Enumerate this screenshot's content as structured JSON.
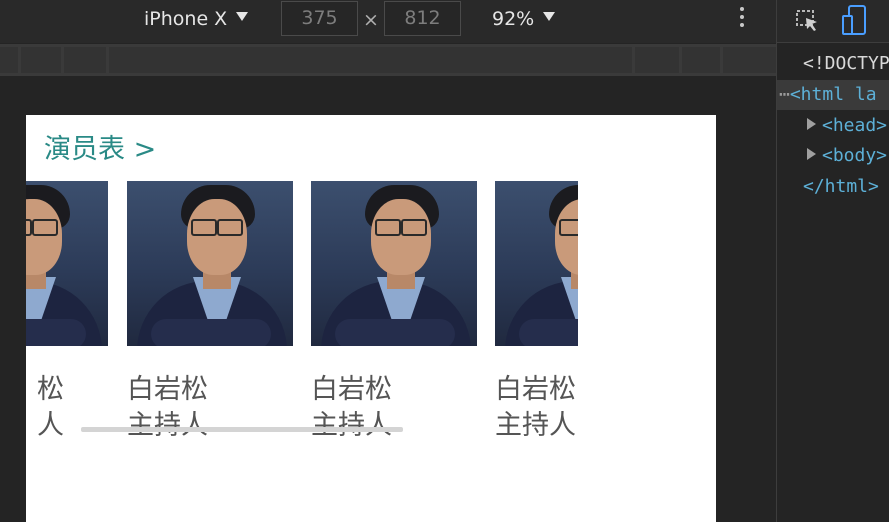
{
  "device_toolbar": {
    "device_name": "iPhone X",
    "width_value": "375",
    "height_value": "812",
    "times_symbol": "×",
    "zoom_value": "92%"
  },
  "page": {
    "section_title": "演员表 >",
    "cast": [
      {
        "name": "白岩松",
        "role": "主持人"
      },
      {
        "name": "白岩松",
        "role": "主持人"
      },
      {
        "name": "白岩松",
        "role": "主持人"
      },
      {
        "name": "白岩松",
        "role": "主持人"
      }
    ],
    "partial_name_glyph": "松",
    "partial_role_glyph": "人"
  },
  "devtools": {
    "doctype_text": "<!DOCTYPE",
    "html_open_dots": "⋯",
    "html_open_text": "<html la",
    "head_text": "<head>",
    "body_text": "<body>",
    "html_close_text": "</html>"
  },
  "colors": {
    "title_teal": "#2a8a86",
    "devtools_tag": "#5db0d7",
    "device_icon_active": "#4a9eff"
  }
}
